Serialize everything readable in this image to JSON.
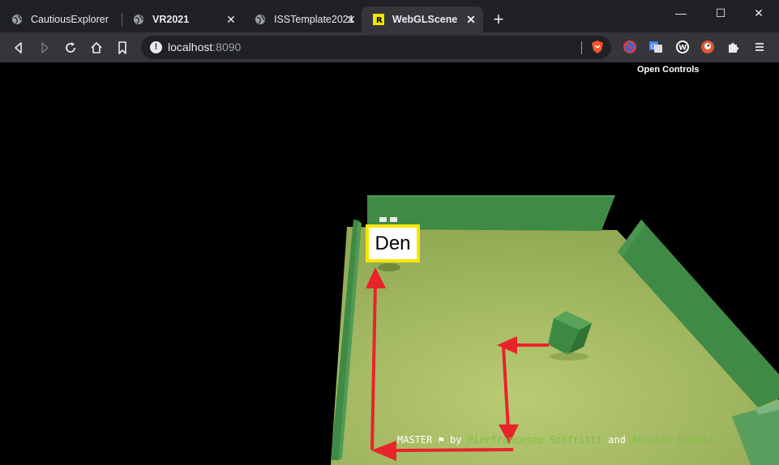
{
  "browser": {
    "tabs": [
      {
        "title": "CautiousExplorer",
        "active": false,
        "icon": "globe-icon"
      },
      {
        "title": "VR2021",
        "active": false,
        "icon": "globe-icon"
      },
      {
        "title": "ISSTemplate2021",
        "active": false,
        "icon": "globe-icon"
      },
      {
        "title": "WebGLScene",
        "active": true,
        "icon": "r-logo-icon"
      }
    ],
    "address": {
      "host": "localhost",
      "port": ":8090"
    },
    "window_controls": {
      "minimize": "—",
      "maximize": "☐",
      "close": "✕"
    }
  },
  "scene": {
    "open_controls": "Open Controls",
    "den_label": "Den",
    "credits": {
      "role": "MASTER",
      "by": "by",
      "author1": "Pierfrancesco Soffritti",
      "and": "and",
      "author2": "Antonio Natali"
    },
    "colors": {
      "floor": "#9fb55a",
      "wall": "#3f8a45",
      "arrow": "#e8232a",
      "label_border": "#f4e600"
    }
  }
}
